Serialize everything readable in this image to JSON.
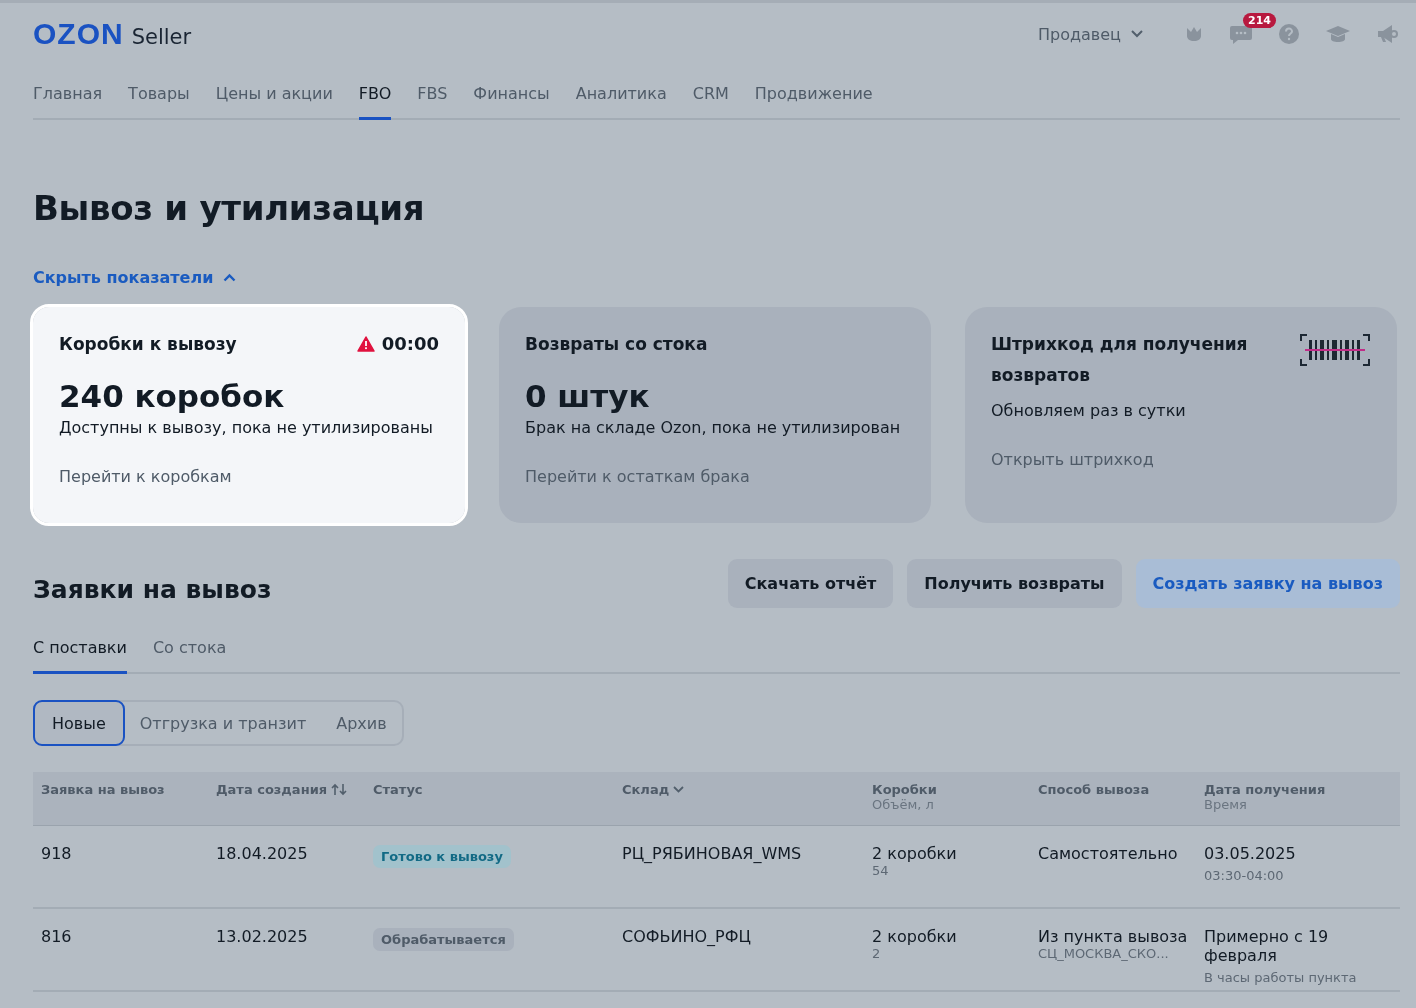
{
  "header": {
    "logo": "OZON",
    "logo_suffix": "Seller",
    "account": "Продавец",
    "messages_badge": "214"
  },
  "nav": [
    {
      "label": "Главная",
      "selected": false
    },
    {
      "label": "Товары",
      "selected": false
    },
    {
      "label": "Цены и акции",
      "selected": false
    },
    {
      "label": "FBO",
      "selected": true
    },
    {
      "label": "FBS",
      "selected": false
    },
    {
      "label": "Финансы",
      "selected": false
    },
    {
      "label": "Аналитика",
      "selected": false
    },
    {
      "label": "CRM",
      "selected": false
    },
    {
      "label": "Продвижение",
      "selected": false
    }
  ],
  "page_title": "Вывоз и утилизация",
  "metrics_toggle": "Скрыть показатели",
  "cards": [
    {
      "title": "Коробки к вывозу",
      "timer": "00:00",
      "value": "240 коробок",
      "description": "Доступны к вывозу, пока не утилизированы",
      "link": "Перейти к коробкам",
      "highlighted": true,
      "kind": "stat"
    },
    {
      "title": "Возвраты со стока",
      "value": "0 штук",
      "description": "Брак на складе Ozon, пока не утилизирован",
      "link": "Перейти к остаткам брака",
      "highlighted": false,
      "kind": "stat"
    },
    {
      "title": "Штрихкод для получения возвратов",
      "description": "Обновляем раз в сутки",
      "link": "Открыть штрихкод",
      "highlighted": false,
      "kind": "barcode"
    }
  ],
  "section_title": "Заявки на вывоз",
  "buttons": [
    {
      "label": "Скачать отчёт",
      "kind": "default"
    },
    {
      "label": "Получить возвраты",
      "kind": "default"
    },
    {
      "label": "Создать заявку на вывоз",
      "kind": "primary"
    }
  ],
  "tabs": [
    {
      "label": "С поставки",
      "selected": true
    },
    {
      "label": "Со стока",
      "selected": false
    }
  ],
  "segments": [
    {
      "label": "Новые",
      "selected": true
    },
    {
      "label": "Отгрузка и транзит",
      "selected": false
    },
    {
      "label": "Архив",
      "selected": false
    }
  ],
  "table": {
    "columns": [
      {
        "label": "Заявка на вывоз",
        "kind": "plain"
      },
      {
        "label": "Дата создания",
        "kind": "sort"
      },
      {
        "label": "Статус",
        "kind": "plain"
      },
      {
        "label": "Склад",
        "kind": "dropdown"
      },
      {
        "label": "Коробки",
        "sublabel": "Объём, л",
        "kind": "plain"
      },
      {
        "label": "Способ вывоза",
        "kind": "plain"
      },
      {
        "label": "Дата получения",
        "sublabel": "Время",
        "kind": "plain"
      }
    ],
    "rows": [
      {
        "id": "918",
        "created": "18.04.2025",
        "status": "Готово к вывозу",
        "kind": "ready",
        "warehouse": "РЦ_РЯБИНОВАЯ_WMS",
        "boxes": "2 коробки",
        "volume": "54",
        "method": "Самостоятельно",
        "date": "03.05.2025",
        "time": "03:30-04:00"
      },
      {
        "id": "816",
        "created": "13.02.2025",
        "status": "Обрабатывается",
        "kind": "processing",
        "warehouse": "СОФЬИНО_РФЦ",
        "boxes": "2 коробки",
        "volume": "2",
        "method": "Из пункта вывоза",
        "method_sub": "СЦ_МОСКВА_СКО...",
        "date": "Примерно с 19 февраля",
        "time": "В часы работы пункта"
      }
    ]
  }
}
